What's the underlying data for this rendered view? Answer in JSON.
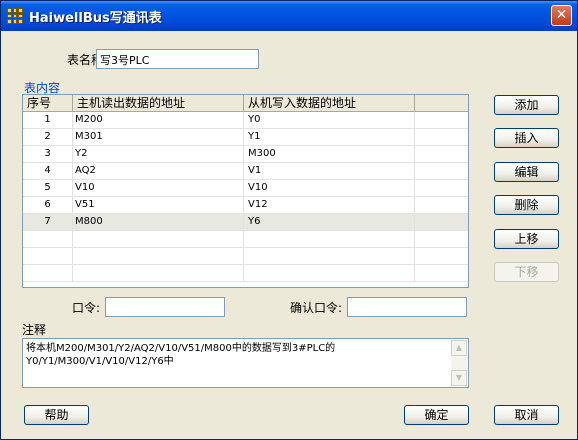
{
  "window": {
    "title": "HaiwellBus写通讯表"
  },
  "form": {
    "table_name_label": "表名称:",
    "table_name_value": "写3号PLC",
    "group_label": "表内容",
    "password_label": "口令:",
    "password_value": "",
    "confirm_password_label": "确认口令:",
    "confirm_password_value": "",
    "notes_label": "注释",
    "notes_lines": [
      "将本机M200/M301/Y2/AQ2/V10/V51/M800中的数据写到3#PLC的",
      "Y0/Y1/M300/V1/V10/V12/Y6中"
    ]
  },
  "table": {
    "columns": [
      "序号",
      "主机读出数据的地址",
      "从机写入数据的地址",
      ""
    ],
    "rows": [
      [
        "1",
        "M200",
        "Y0"
      ],
      [
        "2",
        "M301",
        "Y1"
      ],
      [
        "3",
        "Y2",
        "M300"
      ],
      [
        "4",
        "AQ2",
        "V1"
      ],
      [
        "5",
        "V10",
        "V10"
      ],
      [
        "6",
        "V51",
        "V12"
      ],
      [
        "7",
        "M800",
        "Y6"
      ]
    ],
    "selected_row_index": 6
  },
  "buttons": {
    "add": "添加",
    "insert": "插入",
    "edit": "编辑",
    "delete": "删除",
    "move_up": "上移",
    "move_down": "下移",
    "help": "帮助",
    "ok": "确定",
    "cancel": "取消"
  },
  "icons": {
    "app": "grid-app-icon",
    "close": "close-icon",
    "scroll_up": "scroll-up-arrow-icon",
    "scroll_down": "scroll-down-arrow-icon"
  }
}
